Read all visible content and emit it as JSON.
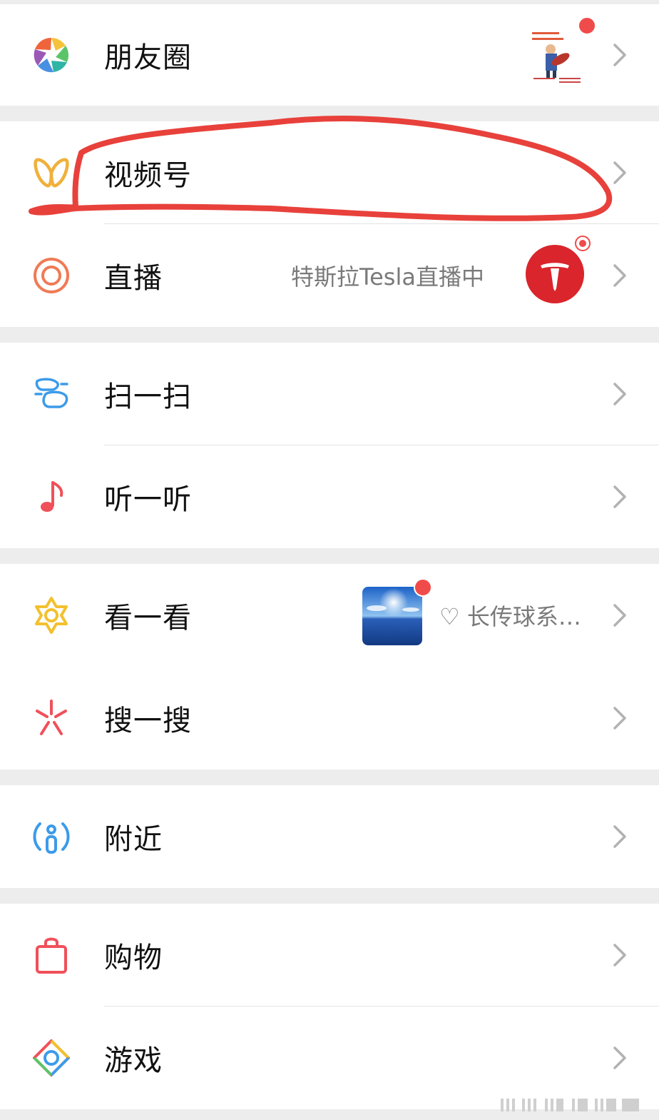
{
  "menu": {
    "moments": {
      "label": "朋友圈",
      "has_badge": true
    },
    "channels": {
      "label": "视频号"
    },
    "live": {
      "label": "直播",
      "status": "特斯拉Tesla直播中",
      "avatar_icon": "tesla-logo-icon",
      "has_badge": true
    },
    "scan": {
      "label": "扫一扫"
    },
    "listen": {
      "label": "听一听"
    },
    "top_stories": {
      "label": "看一看",
      "preview": "♡ 长传球系…",
      "has_badge": true
    },
    "search": {
      "label": "搜一搜"
    },
    "nearby": {
      "label": "附近"
    },
    "shopping": {
      "label": "购物"
    },
    "games": {
      "label": "游戏"
    }
  },
  "colors": {
    "background": "#ededed",
    "row": "#ffffff",
    "badge": "#f04b4b",
    "annotation": "#e8413b",
    "tesla": "#d9252b"
  },
  "icons": {
    "moments": "aperture-icon",
    "channels": "butterfly-icon",
    "live": "ring-icon",
    "scan": "scan-icon",
    "listen": "music-note-icon",
    "top_stories": "star-flower-icon",
    "search": "sparkle-icon",
    "nearby": "location-person-icon",
    "shopping": "shopping-bag-icon",
    "games": "diamond-game-icon",
    "chevron": "chevron-right-icon"
  }
}
